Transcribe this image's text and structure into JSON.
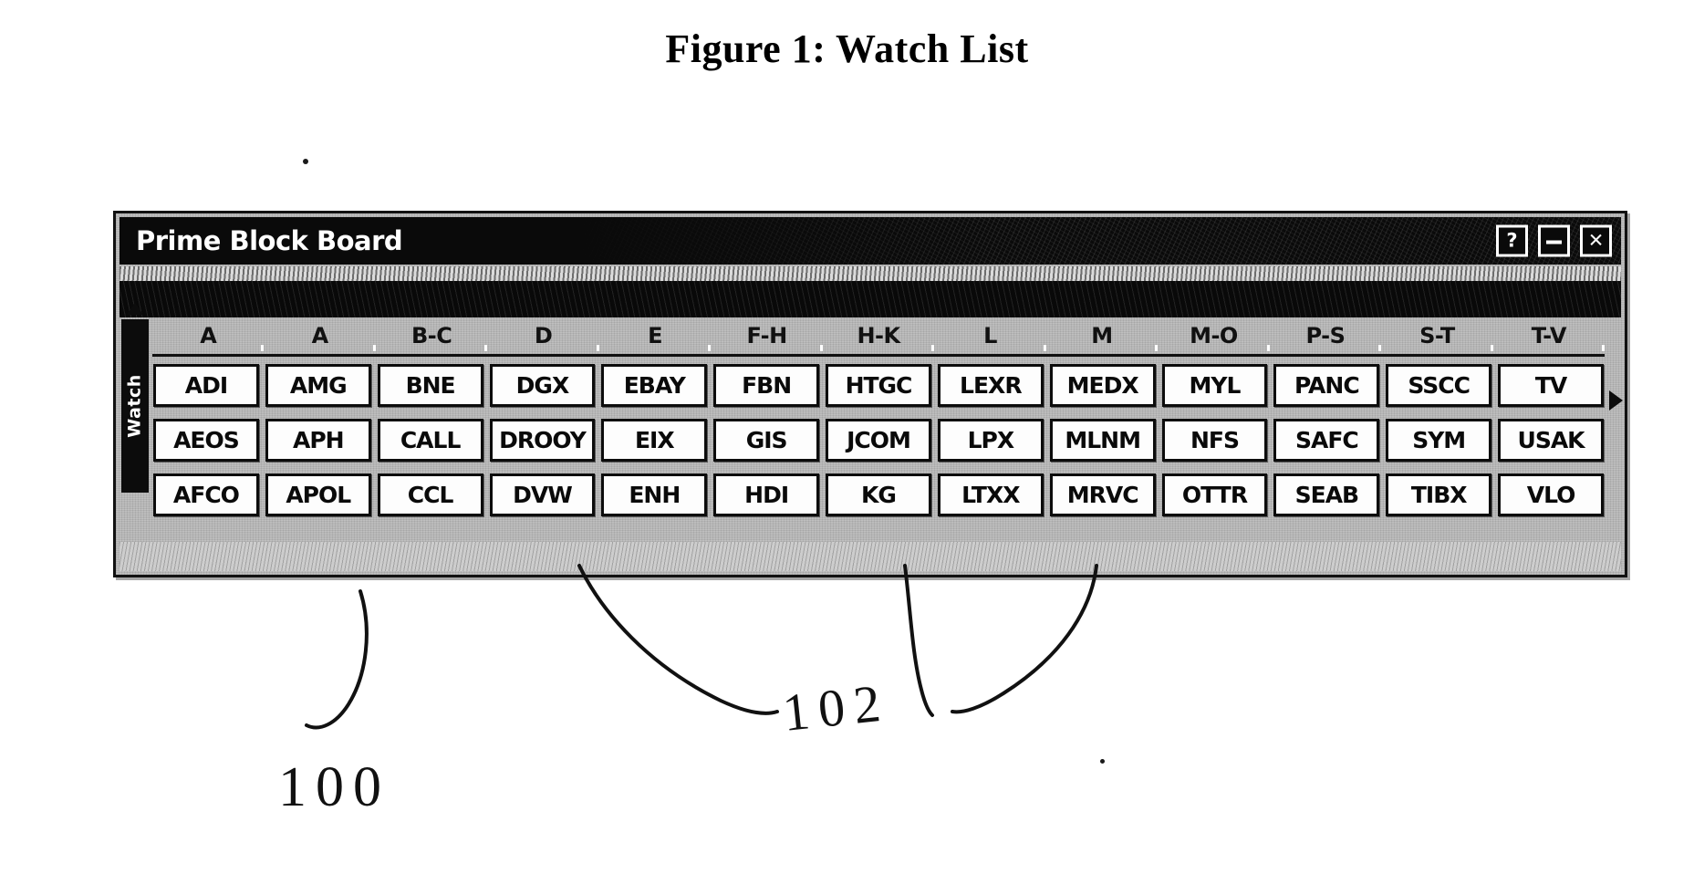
{
  "figure": {
    "caption": "Figure 1: Watch List"
  },
  "window": {
    "title": "Prime Block Board",
    "controls": [
      {
        "name": "help-button",
        "label": "?"
      },
      {
        "name": "minimize-button",
        "label": "—"
      },
      {
        "name": "close-button",
        "label": "✕"
      }
    ],
    "side_tab": {
      "label": "Watch"
    },
    "board": {
      "column_headers": [
        "A",
        "A",
        "B-C",
        "D",
        "E",
        "F-H",
        "H-K",
        "L",
        "M",
        "M-O",
        "P-S",
        "S-T",
        "T-V"
      ],
      "rows": [
        [
          "ADI",
          "AMG",
          "BNE",
          "DGX",
          "EBAY",
          "FBN",
          "HTGC",
          "LEXR",
          "MEDX",
          "MYL",
          "PANC",
          "SSCC",
          "TV"
        ],
        [
          "AEOS",
          "APH",
          "CALL",
          "DROOY",
          "EIX",
          "GIS",
          "JCOM",
          "LPX",
          "MLNM",
          "NFS",
          "SAFC",
          "SYM",
          "USAK"
        ],
        [
          "AFCO",
          "APOL",
          "CCL",
          "DVW",
          "ENH",
          "HDI",
          "KG",
          "LTXX",
          "MRVC",
          "OTTR",
          "SEAB",
          "TIBX",
          "VLO"
        ]
      ]
    }
  },
  "annotations": [
    {
      "name": "reference-numeral-100",
      "label": "100"
    },
    {
      "name": "reference-numeral-102",
      "label": "102"
    }
  ]
}
